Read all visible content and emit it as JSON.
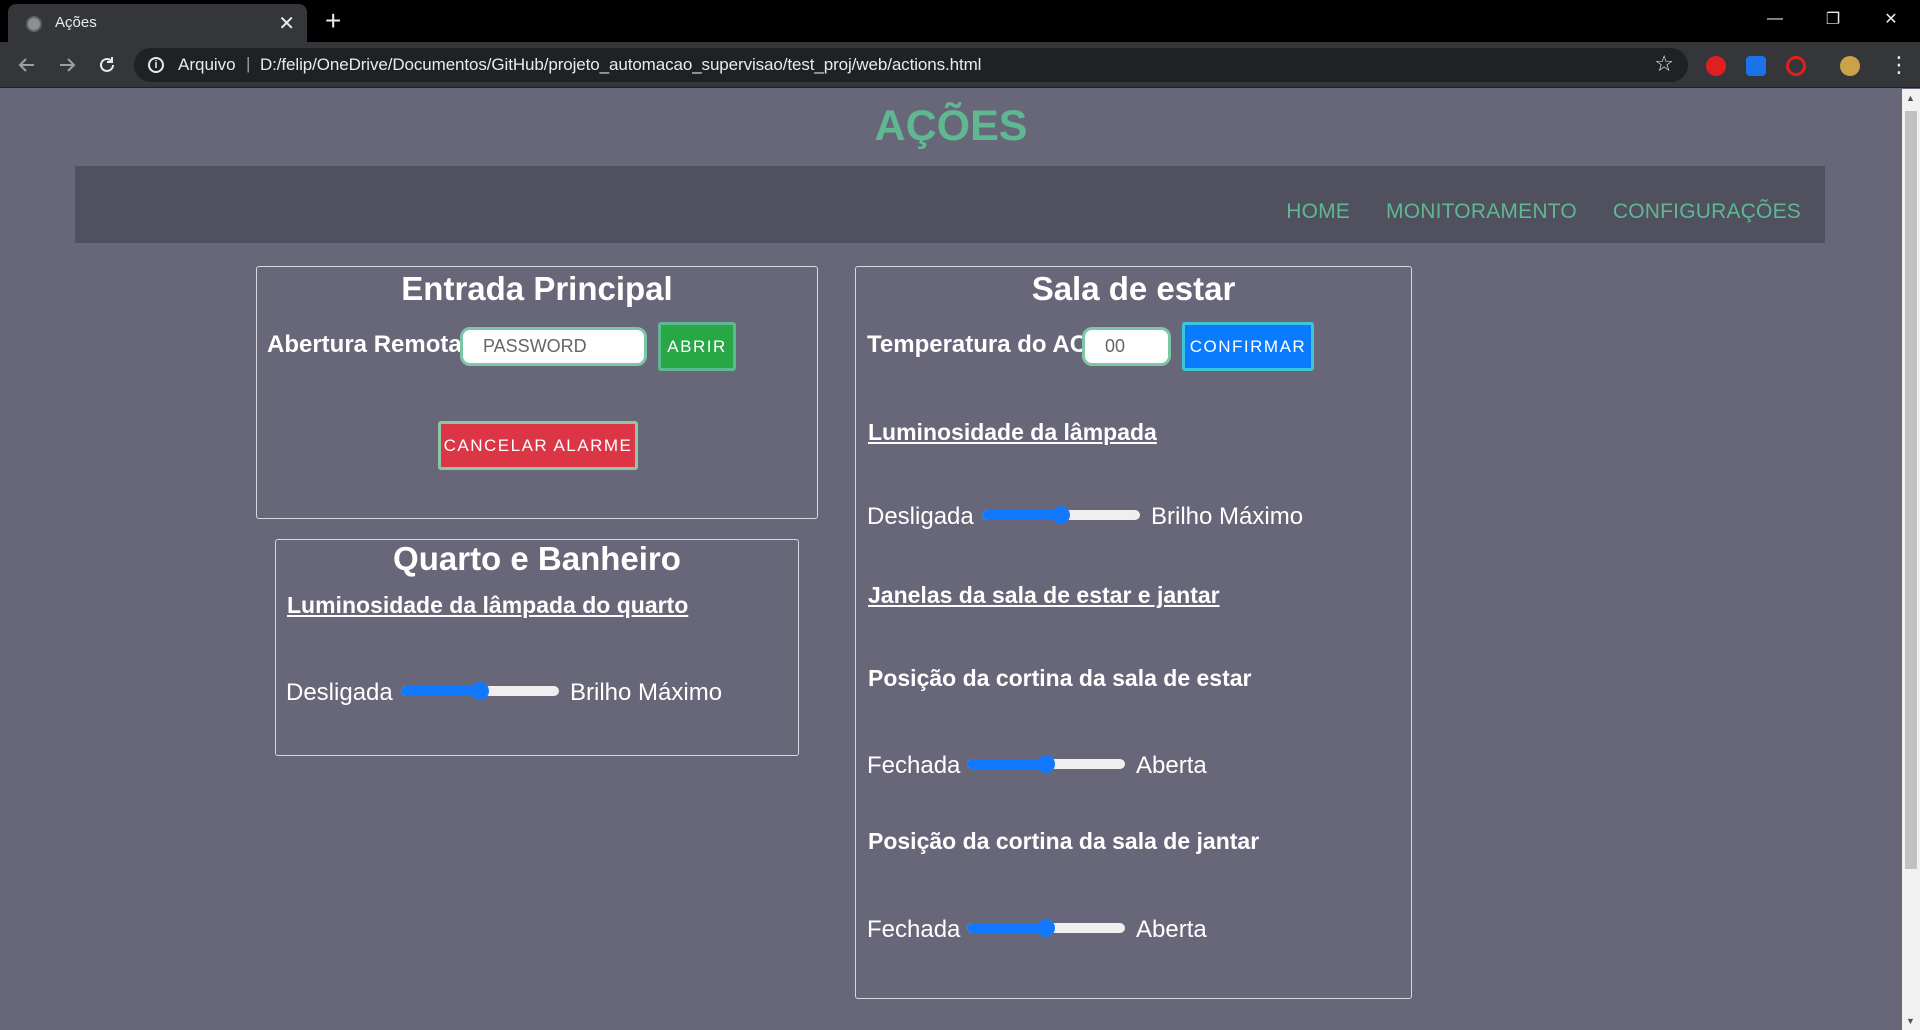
{
  "browser": {
    "tab_title": "Ações",
    "tab_close": "✕",
    "new_tab": "+",
    "scheme": "Arquivo",
    "separator": "|",
    "url": "D:/felip/OneDrive/Documentos/GitHub/projeto_automacao_supervisao/test_proj/web/actions.html",
    "window_controls": {
      "minimize": "—",
      "restore": "❐",
      "close": "✕"
    }
  },
  "page": {
    "title": "AÇÕES"
  },
  "nav": {
    "links": [
      "HOME",
      "MONITORAMENTO",
      "CONFIGURAÇÕES"
    ]
  },
  "entrada": {
    "title": "Entrada Principal",
    "remote_label": "Abertura Remota",
    "password_placeholder": "PASSWORD",
    "open_button": "ABRIR",
    "cancel_alarm_button": "CANCELAR ALARME"
  },
  "quarto": {
    "title": "Quarto e Banheiro",
    "lamp_heading": "Luminosidade da lâmpada do quarto",
    "min_label": "Desligada",
    "max_label": "Brilho Máximo",
    "lamp_level": 0.5
  },
  "sala": {
    "title": "Sala de estar",
    "ac_label": "Temperatura do AC",
    "ac_placeholder": "00",
    "confirm_button": "CONFIRMAR",
    "lamp_heading": "Luminosidade da lâmpada",
    "lamp_min": "Desligada",
    "lamp_max": "Brilho Máximo",
    "lamp_level": 0.5,
    "windows_heading": "Janelas da sala de estar e jantar",
    "curtain_living_label": "Posição da cortina da sala de estar",
    "curtain_living_min": "Fechada",
    "curtain_living_max": "Aberta",
    "curtain_living_level": 0.5,
    "curtain_dining_label": "Posição da cortina da sala de jantar",
    "curtain_dining_min": "Fechada",
    "curtain_dining_max": "Aberta",
    "curtain_dining_level": 0.5
  },
  "colors": {
    "accent_green": "#5fb892",
    "button_green": "#28a745",
    "button_red": "#dc3545",
    "button_blue": "#0a7bff",
    "slider_blue": "#1279ff",
    "page_background": "#676779",
    "navbar_background": "#50505f"
  }
}
